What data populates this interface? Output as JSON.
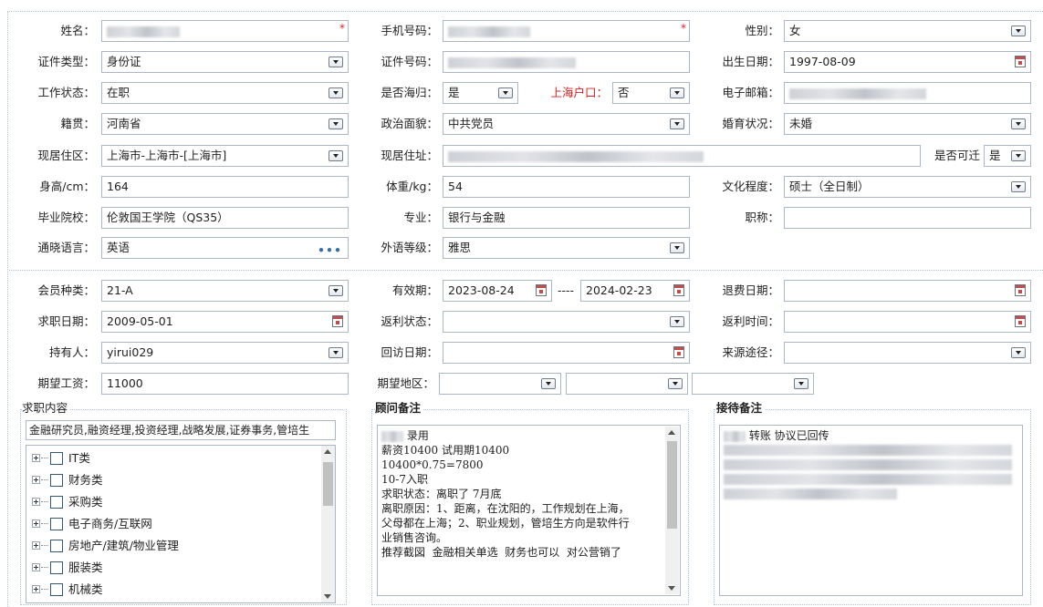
{
  "personal": {
    "name": {
      "label": "姓名：",
      "value": ""
    },
    "phone": {
      "label": "手机号码：",
      "value": ""
    },
    "gender": {
      "label": "性别：",
      "value": "女"
    },
    "id_type": {
      "label": "证件类型：",
      "value": "身份证"
    },
    "id_number": {
      "label": "证件号码：",
      "value": ""
    },
    "birth_date": {
      "label": "出生日期：",
      "value": "1997-08-09"
    },
    "work_status": {
      "label": "工作状态：",
      "value": "在职"
    },
    "returnee": {
      "label": "是否海归：",
      "value": "是"
    },
    "shanghai_hukou": {
      "label": "上海户口：",
      "value": "否"
    },
    "email": {
      "label": "电子邮箱：",
      "value": ""
    },
    "native_place": {
      "label": "籍贯：",
      "value": "河南省"
    },
    "political_status": {
      "label": "政治面貌：",
      "value": "中共党员"
    },
    "marital_status": {
      "label": "婚育状况：",
      "value": "未婚"
    },
    "residence_area": {
      "label": "现居住区：",
      "value": "上海市-上海市-[上海市]"
    },
    "residence_address": {
      "label": "现居住址：",
      "value": ""
    },
    "relocatable": {
      "label": "是否可迁",
      "value": "是"
    },
    "height": {
      "label": "身高/cm：",
      "value": "164"
    },
    "weight": {
      "label": "体重/kg：",
      "value": "54"
    },
    "education": {
      "label": "文化程度：",
      "value": "硕士（全日制）"
    },
    "school": {
      "label": "毕业院校：",
      "value": "伦敦国王学院（QS35）"
    },
    "major": {
      "label": "专业：",
      "value": "银行与金融"
    },
    "title": {
      "label": "职称：",
      "value": ""
    },
    "language": {
      "label": "通晓语言：",
      "value": "英语",
      "more": "•••"
    },
    "language_level": {
      "label": "外语等级：",
      "value": "雅思"
    }
  },
  "membership": {
    "member_type": {
      "label": "会员种类：",
      "value": "21-A"
    },
    "valid_period": {
      "label": "有效期：",
      "start": "2023-08-24",
      "separator": "----",
      "end": "2024-02-23"
    },
    "refund_date": {
      "label": "退费日期：",
      "value": ""
    },
    "job_seek_date": {
      "label": "求职日期：",
      "value": "2009-05-01"
    },
    "rebate_status": {
      "label": "返利状态：",
      "value": ""
    },
    "rebate_time": {
      "label": "返利时间：",
      "value": ""
    },
    "holder": {
      "label": "持有人：",
      "value": "yirui029"
    },
    "visit_date": {
      "label": "回访日期：",
      "value": ""
    },
    "source": {
      "label": "来源途径：",
      "value": ""
    },
    "expected_salary": {
      "label": "期望工资：",
      "value": "11000"
    },
    "expected_region": {
      "label": "期望地区：",
      "values": [
        "",
        "",
        ""
      ]
    }
  },
  "job_content": {
    "title": "求职内容",
    "summary": "金融研究员,融资经理,投资经理,战略发展,证券事务,管培生",
    "tree": [
      {
        "label": "IT类"
      },
      {
        "label": "财务类"
      },
      {
        "label": "采购类"
      },
      {
        "label": "电子商务/互联网"
      },
      {
        "label": "房地产/建筑/物业管理"
      },
      {
        "label": "服装类"
      },
      {
        "label": "机械类"
      }
    ]
  },
  "consultant_notes": {
    "title": "顾问备注",
    "lines": [
      "录用",
      "薪资10400 试用期10400",
      "10400*0.75=7800",
      "10-7入职",
      "",
      "",
      "",
      "求职状态：离职了 7月底",
      "离职原因：1、距离，在沈阳的，工作规划在上海，",
      "父母都在上海；2、职业规划，管培生方向是软件行",
      "业销售咨询。",
      "推荐截図  金融相关单选  财务也可以  对公营销了"
    ]
  },
  "reception_notes": {
    "title": "接待备注",
    "first_line": "转账 协议已回传"
  }
}
